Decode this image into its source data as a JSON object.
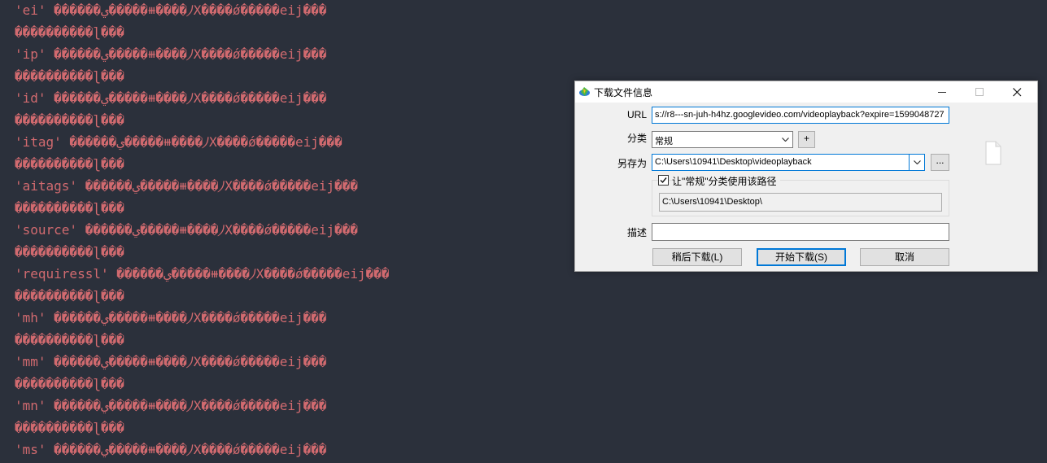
{
  "terminal": {
    "lines": [
      "'ei' ������ي�����⧻����⵰X����ǿ�����eij���",
      "����������ɭ���",
      "'ip' ������ي�����⧻����⵰X����ǿ�����eij���",
      "����������ɭ���",
      "'id' ������ي�����⧻����⵰X����ǿ�����eij���",
      "����������ɭ���",
      "'itag' ������ي�����⧻����⵰X����ǿ�����eij���",
      "����������ɭ���",
      "'aitags' ������ي�����⧻����⵰X����ǿ�����eij���",
      "����������ɭ���",
      "'source' ������ي�����⧻����⵰X����ǿ�����eij���",
      "����������ɭ���",
      "'requiressl' ������ي�����⧻����⵰X����ǿ�����eij���",
      "����������ɭ���",
      "'mh' ������ي�����⧻����⵰X����ǿ�����eij���",
      "����������ɭ���",
      "'mm' ������ي�����⧻����⵰X����ǿ�����eij���",
      "����������ɭ���",
      "'mn' ������ي�����⧻����⵰X����ǿ�����eij���",
      "����������ɭ���",
      "'ms' ������ي�����⧻����⵰X����ǿ�����eij���"
    ]
  },
  "dialog": {
    "title": "下载文件信息",
    "url_label": "URL",
    "url_value": "s://r8---sn-juh-h4hz.googlevideo.com/videoplayback?expire=1599048727",
    "category_label": "分类",
    "category_value": "常规",
    "add_label": "+",
    "save_as_label": "另存为",
    "save_as_value": "C:\\Users\\10941\\Desktop\\videoplayback",
    "browse_label": "...",
    "remember_label": "让\"常规\"分类使用该路径",
    "remember_checked": true,
    "category_path": "C:\\Users\\10941\\Desktop\\",
    "description_label": "描述",
    "description_value": "",
    "later_button": "稍后下载(L)",
    "start_button": "开始下载(S)",
    "cancel_button": "取消"
  },
  "colors": {
    "terminal_bg": "#2b303b",
    "terminal_text": "#d16a6f",
    "accent": "#0078d7"
  }
}
